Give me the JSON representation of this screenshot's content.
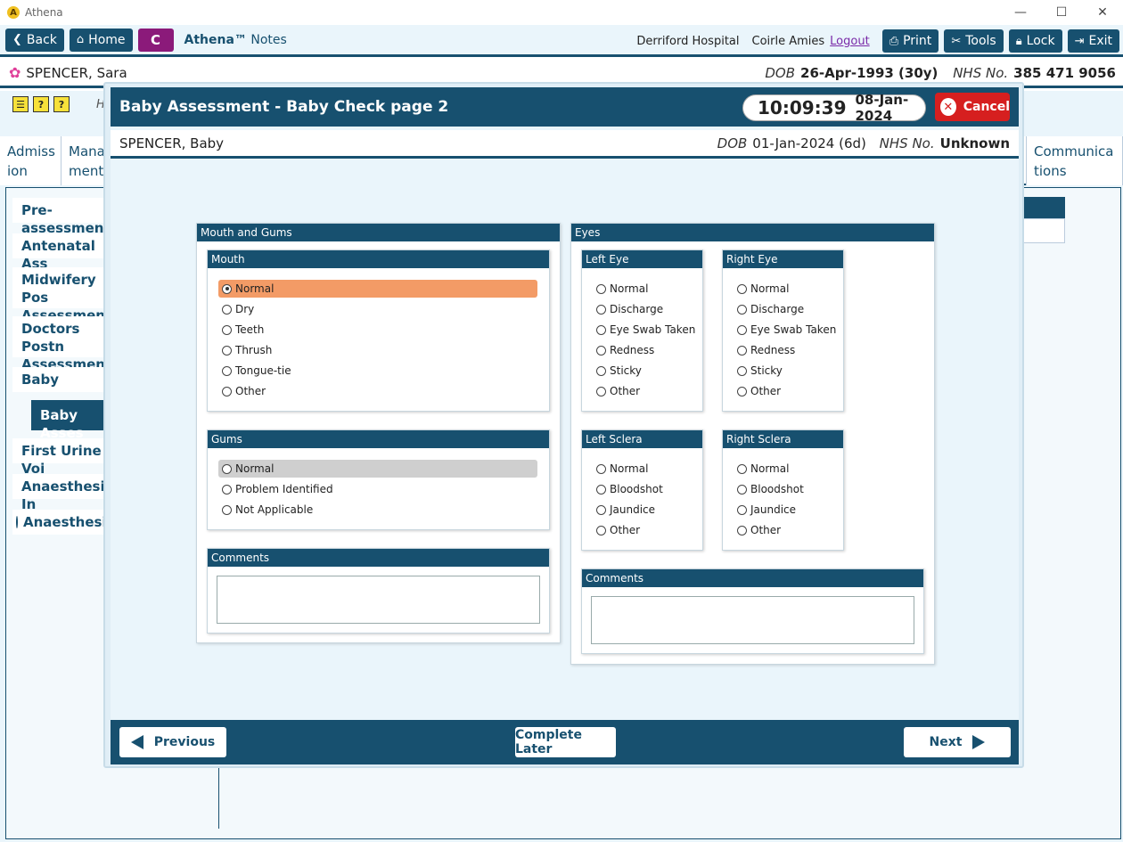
{
  "window": {
    "title": "Athena",
    "logo": "A"
  },
  "toolbar": {
    "back": "Back",
    "home": "Home",
    "c": "C",
    "brand": "Athena™",
    "brand_suffix": "Notes",
    "hospital": "Derriford Hospital",
    "user": "Coirle Amies",
    "logout": "Logout",
    "print": "Print",
    "tools": "Tools",
    "lock": "Lock",
    "exit": "Exit"
  },
  "patient": {
    "name": "SPENCER, Sara",
    "dob_label": "DOB",
    "dob": "26-Apr-1993 (30y)",
    "nhs_label": "NHS No.",
    "nhs": "385 471 9056"
  },
  "background": {
    "header_letter": "H",
    "tabs": [
      {
        "line1": "Admiss",
        "line2": "ion"
      },
      {
        "line1": "Mana",
        "line2": "ment"
      },
      {
        "line1": "Communica",
        "line2": "tions"
      }
    ],
    "sidebar": [
      {
        "label": "Pre-assessmen"
      },
      {
        "label": "Antenatal Ass"
      },
      {
        "label": "Midwifery Pos",
        "label2": "Assessments"
      },
      {
        "label": "Doctors Postn",
        "label2": "Assessments"
      },
      {
        "label": "Baby"
      },
      {
        "label": "Baby Asses"
      },
      {
        "label": "First Urine Voi"
      },
      {
        "label": "Anaesthesia In"
      },
      {
        "label": "Anaesthesia"
      }
    ]
  },
  "modal": {
    "title": "Baby Assessment - Baby Check page 2",
    "time": "10:09:39",
    "date": "08-Jan-2024",
    "cancel": "Cancel",
    "baby_name": "SPENCER, Baby",
    "dob_label": "DOB",
    "dob": "01-Jan-2024 (6d)",
    "nhs_label": "NHS No.",
    "nhs": "Unknown",
    "mouth_gums": {
      "title": "Mouth and Gums",
      "mouth": {
        "title": "Mouth",
        "options": [
          "Normal",
          "Dry",
          "Teeth",
          "Thrush",
          "Tongue-tie",
          "Other"
        ],
        "selected": "Normal"
      },
      "gums": {
        "title": "Gums",
        "options": [
          "Normal",
          "Problem Identified",
          "Not Applicable"
        ],
        "highlighted": "Normal"
      },
      "comments": {
        "title": "Comments"
      }
    },
    "eyes": {
      "title": "Eyes",
      "left_eye": {
        "title": "Left Eye",
        "options": [
          "Normal",
          "Discharge",
          "Eye Swab Taken",
          "Redness",
          "Sticky",
          "Other"
        ]
      },
      "right_eye": {
        "title": "Right Eye",
        "options": [
          "Normal",
          "Discharge",
          "Eye Swab Taken",
          "Redness",
          "Sticky",
          "Other"
        ]
      },
      "left_sclera": {
        "title": "Left Sclera",
        "options": [
          "Normal",
          "Bloodshot",
          "Jaundice",
          "Other"
        ]
      },
      "right_sclera": {
        "title": "Right Sclera",
        "options": [
          "Normal",
          "Bloodshot",
          "Jaundice",
          "Other"
        ]
      },
      "comments": {
        "title": "Comments"
      }
    },
    "footer": {
      "previous": "Previous",
      "complete_later": "Complete Later",
      "next": "Next"
    }
  }
}
